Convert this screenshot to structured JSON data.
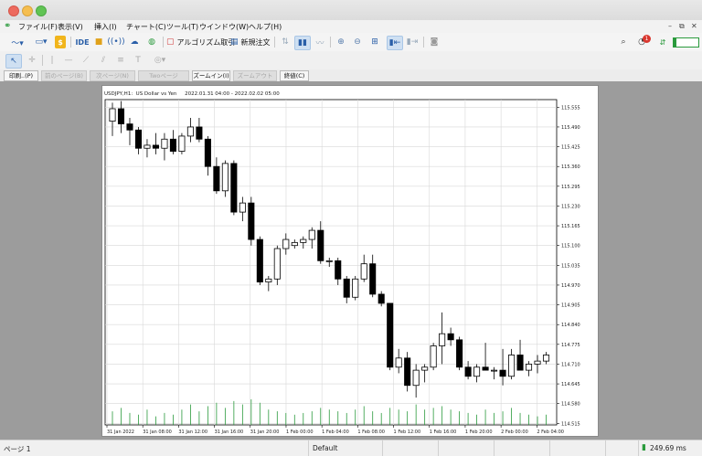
{
  "menu": [
    "ファイル(F)",
    "表示(V)",
    "挿入(I)",
    "チャート(C)",
    "ツール(T)",
    "ウインドウ(W)",
    "ヘルプ(H)"
  ],
  "toolbar": {
    "ide_label": "IDE",
    "algo_label": "アルゴリズム取引",
    "new_order_label": "新規注文",
    "notification_count": "1"
  },
  "print_toolbar": {
    "print": "印刷..(P)",
    "prev_page": "前のページ(B)",
    "next_page": "次ページ(N)",
    "two_pages": "Twoページ",
    "zoom_in": "ズームイン(I)",
    "zoom_out": "ズームアウト(O)",
    "close": "終値(C)"
  },
  "chart_header": "USDJPY,H1:  US Dollar vs Yen     2022.01.31 04:00 - 2022.02.02 05:00",
  "status": {
    "page": "ページ 1",
    "profile": "Default",
    "ping": "249.69 ms"
  },
  "chart_data": {
    "type": "candlestick",
    "symbol": "USDJPY",
    "timeframe": "H1",
    "ylim": [
      114.51,
      115.58
    ],
    "yticks": [
      "115.555",
      "115.490",
      "115.425",
      "115.360",
      "115.295",
      "115.230",
      "115.165",
      "115.100",
      "115.035",
      "114.970",
      "114.905",
      "114.840",
      "114.775",
      "114.710",
      "114.645",
      "114.580",
      "114.515"
    ],
    "xticks": [
      "31 Jan 2022",
      "31 Jan 08:00",
      "31 Jan 12:00",
      "31 Jan 16:00",
      "31 Jan 20:00",
      "1 Feb 00:00",
      "1 Feb 04:00",
      "1 Feb 08:00",
      "1 Feb 12:00",
      "1 Feb 16:00",
      "1 Feb 20:00",
      "2 Feb 00:00",
      "2 Feb 04:00"
    ],
    "candles": [
      [
        115.509,
        115.57,
        115.46,
        115.55
      ],
      [
        115.55,
        115.575,
        115.47,
        115.5
      ],
      [
        115.5,
        115.52,
        115.43,
        115.48
      ],
      [
        115.48,
        115.49,
        115.4,
        115.42
      ],
      [
        115.42,
        115.45,
        115.39,
        115.43
      ],
      [
        115.43,
        115.47,
        115.4,
        115.42
      ],
      [
        115.42,
        115.47,
        115.38,
        115.45
      ],
      [
        115.45,
        115.48,
        115.4,
        115.41
      ],
      [
        115.41,
        115.47,
        115.4,
        115.46
      ],
      [
        115.46,
        115.52,
        115.44,
        115.49
      ],
      [
        115.49,
        115.52,
        115.44,
        115.45
      ],
      [
        115.45,
        115.46,
        115.33,
        115.36
      ],
      [
        115.36,
        115.39,
        115.27,
        115.28
      ],
      [
        115.28,
        115.38,
        115.26,
        115.37
      ],
      [
        115.37,
        115.38,
        115.2,
        115.21
      ],
      [
        115.21,
        115.26,
        115.18,
        115.24
      ],
      [
        115.24,
        115.26,
        115.1,
        115.12
      ],
      [
        115.12,
        115.13,
        114.97,
        114.98
      ],
      [
        114.98,
        115.0,
        114.95,
        114.99
      ],
      [
        114.99,
        115.1,
        114.97,
        115.09
      ],
      [
        115.09,
        115.14,
        115.07,
        115.12
      ],
      [
        115.1,
        115.12,
        115.09,
        115.11
      ],
      [
        115.11,
        115.13,
        115.09,
        115.12
      ],
      [
        115.12,
        115.16,
        115.09,
        115.15
      ],
      [
        115.15,
        115.18,
        115.04,
        115.05
      ],
      [
        115.05,
        115.06,
        115.03,
        115.05
      ],
      [
        115.05,
        115.06,
        114.97,
        114.99
      ],
      [
        114.99,
        115.0,
        114.91,
        114.93
      ],
      [
        114.93,
        115.0,
        114.92,
        114.99
      ],
      [
        114.99,
        115.07,
        114.98,
        115.04
      ],
      [
        115.04,
        115.07,
        114.93,
        114.94
      ],
      [
        114.94,
        114.95,
        114.9,
        114.91
      ],
      [
        114.91,
        114.91,
        114.69,
        114.7
      ],
      [
        114.7,
        114.76,
        114.68,
        114.73
      ],
      [
        114.73,
        114.75,
        114.62,
        114.64
      ],
      [
        114.64,
        114.71,
        114.6,
        114.69
      ],
      [
        114.69,
        114.71,
        114.65,
        114.7
      ],
      [
        114.7,
        114.78,
        114.69,
        114.77
      ],
      [
        114.77,
        114.88,
        114.71,
        114.81
      ],
      [
        114.81,
        114.83,
        114.77,
        114.79
      ],
      [
        114.79,
        114.8,
        114.69,
        114.7
      ],
      [
        114.7,
        114.72,
        114.66,
        114.67
      ],
      [
        114.67,
        114.71,
        114.65,
        114.7
      ],
      [
        114.7,
        114.78,
        114.69,
        114.69
      ],
      [
        114.69,
        114.7,
        114.66,
        114.69
      ],
      [
        114.69,
        114.76,
        114.64,
        114.67
      ],
      [
        114.67,
        114.76,
        114.66,
        114.74
      ],
      [
        114.74,
        114.79,
        114.69,
        114.69
      ],
      [
        114.69,
        114.72,
        114.67,
        114.71
      ],
      [
        114.71,
        114.74,
        114.68,
        114.72
      ],
      [
        114.72,
        114.75,
        114.71,
        114.74
      ]
    ],
    "volume": [
      8,
      10,
      7,
      6,
      9,
      5,
      7,
      6,
      9,
      12,
      8,
      11,
      13,
      10,
      14,
      12,
      15,
      13,
      9,
      8,
      7,
      6,
      7,
      8,
      10,
      9,
      8,
      7,
      9,
      11,
      8,
      7,
      10,
      9,
      8,
      12,
      9,
      10,
      11,
      9,
      8,
      7,
      6,
      9,
      7,
      8,
      10,
      7,
      6,
      5,
      6
    ]
  }
}
